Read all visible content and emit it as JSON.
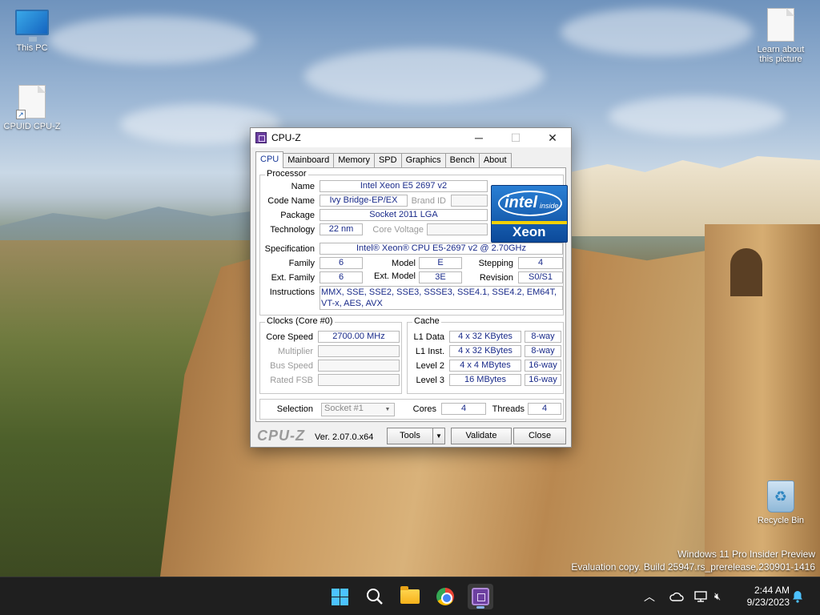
{
  "desktop": {
    "icons": [
      {
        "label": "This PC"
      },
      {
        "label": "CPUID CPU-Z"
      },
      {
        "label": "Learn about this picture"
      },
      {
        "label": "Recycle Bin"
      }
    ],
    "watermark_line1": "Windows 11 Pro Insider Preview",
    "watermark_line2": "Evaluation copy. Build 25947.rs_prerelease.230901-1416"
  },
  "window": {
    "title": "CPU-Z",
    "tabs": [
      {
        "label": "CPU"
      },
      {
        "label": "Mainboard"
      },
      {
        "label": "Memory"
      },
      {
        "label": "SPD"
      },
      {
        "label": "Graphics"
      },
      {
        "label": "Bench"
      },
      {
        "label": "About"
      }
    ],
    "processor": {
      "group_title": "Processor",
      "name_label": "Name",
      "name": "Intel Xeon E5 2697 v2",
      "codename_label": "Code Name",
      "codename": "Ivy Bridge-EP/EX",
      "brandid_label": "Brand ID",
      "brandid": "",
      "package_label": "Package",
      "package": "Socket 2011 LGA",
      "technology_label": "Technology",
      "technology": "22 nm",
      "corevoltage_label": "Core Voltage",
      "corevoltage": "",
      "spec_label": "Specification",
      "spec": "Intel® Xeon® CPU E5-2697 v2 @ 2.70GHz",
      "family_label": "Family",
      "family": "6",
      "model_label": "Model",
      "model": "E",
      "stepping_label": "Stepping",
      "stepping": "4",
      "extfamily_label": "Ext. Family",
      "extfamily": "6",
      "extmodel_label": "Ext. Model",
      "extmodel": "3E",
      "revision_label": "Revision",
      "revision": "S0/S1",
      "instructions_label": "Instructions",
      "instructions": "MMX, SSE, SSE2, SSE3, SSSE3, SSE4.1, SSE4.2, EM64T, VT-x, AES, AVX",
      "badge_intel": "intel",
      "badge_inside": "inside",
      "badge_xeon": "Xeon"
    },
    "clocks": {
      "group_title": "Clocks (Core #0)",
      "corespeed_label": "Core Speed",
      "corespeed": "2700.00 MHz",
      "multiplier_label": "Multiplier",
      "multiplier": "",
      "busspeed_label": "Bus Speed",
      "busspeed": "",
      "ratedfsb_label": "Rated FSB",
      "ratedfsb": ""
    },
    "cache": {
      "group_title": "Cache",
      "rows": [
        {
          "label": "L1 Data",
          "size": "4 x 32 KBytes",
          "way": "8-way"
        },
        {
          "label": "L1 Inst.",
          "size": "4 x 32 KBytes",
          "way": "8-way"
        },
        {
          "label": "Level 2",
          "size": "4 x 4 MBytes",
          "way": "16-way"
        },
        {
          "label": "Level 3",
          "size": "16 MBytes",
          "way": "16-way"
        }
      ]
    },
    "selection": {
      "label": "Selection",
      "value": "Socket #1",
      "cores_label": "Cores",
      "cores": "4",
      "threads_label": "Threads",
      "threads": "4"
    },
    "footer": {
      "logo": "CPU-Z",
      "version": "Ver. 2.07.0.x64",
      "tools": "Tools",
      "validate": "Validate",
      "close": "Close"
    }
  },
  "taskbar": {
    "time": "2:44 AM",
    "date": "9/23/2023"
  },
  "colors": {
    "value_text": "#1a2b8a",
    "taskbar_bg": "#1f1f1f",
    "accent": "#4cc2ff"
  }
}
